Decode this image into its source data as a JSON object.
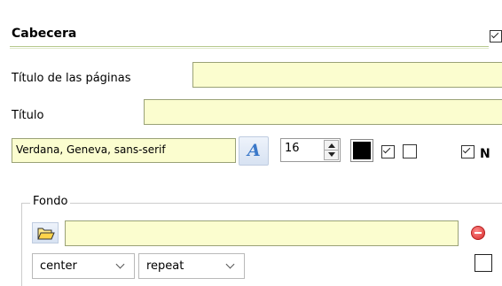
{
  "header": {
    "title": "Cabecera"
  },
  "fields": {
    "page_title_label": "Título de las páginas",
    "page_title_value": "",
    "title_label": "Título",
    "title_value": ""
  },
  "font": {
    "family_value": "Verdana, Geneva, sans-serif",
    "font_button_glyph": "A",
    "size_value": "16",
    "color": "#000000",
    "bold_label": "N",
    "bold_checked": true,
    "check1_checked": true,
    "check2_checked": false
  },
  "fondo": {
    "legend": "Fondo",
    "path_value": "",
    "position_selected": "center",
    "repeat_selected": "repeat",
    "checkbox_checked": false
  },
  "colors": {
    "input_background": "#fbfdcf",
    "accent_line": "#b6c98e",
    "remove_icon": "#d62a2a",
    "font_button_text": "#3b78c9"
  },
  "icons": {
    "font": "font-icon",
    "folder": "folder-open-icon",
    "remove": "remove-icon",
    "spin_up": "arrow-up-icon",
    "spin_down": "arrow-down-icon"
  }
}
